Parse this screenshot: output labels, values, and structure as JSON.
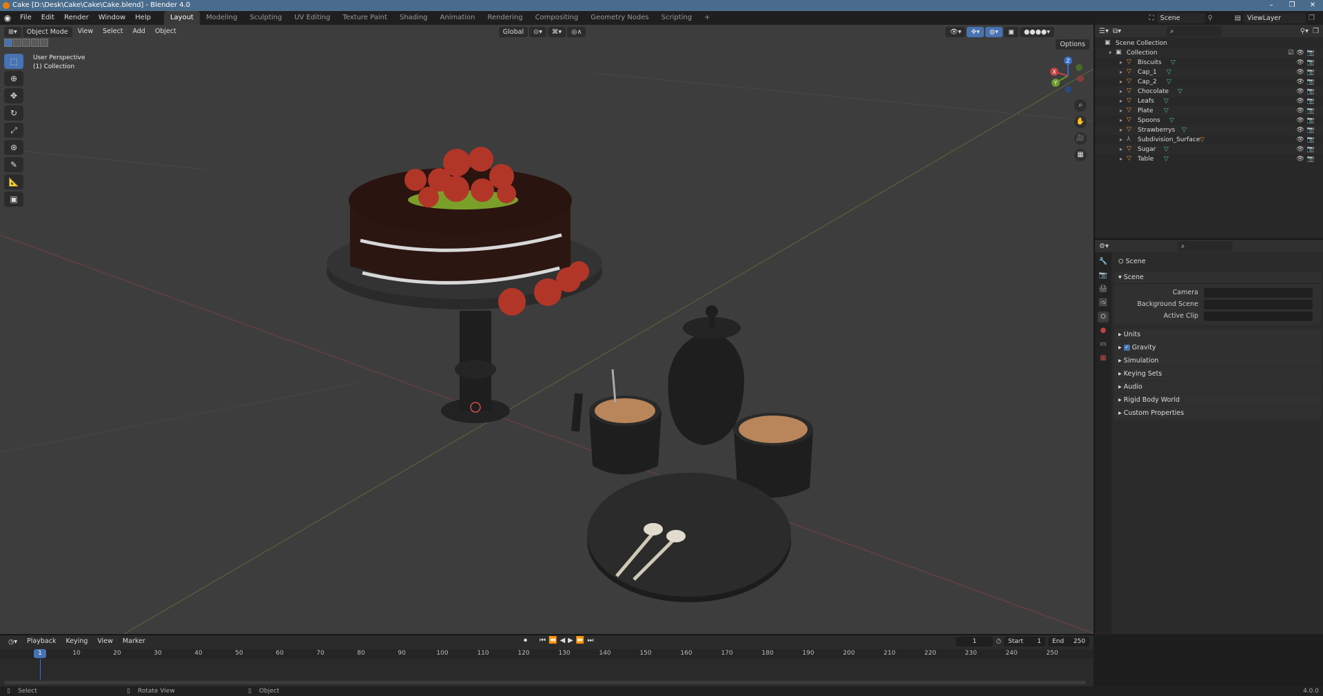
{
  "window": {
    "title": "Cake [D:\\Desk\\Cake\\Cake\\Cake.blend] - Blender 4.0",
    "controls": [
      "–",
      "❐",
      "✕"
    ]
  },
  "menu": [
    "File",
    "Edit",
    "Render",
    "Window",
    "Help"
  ],
  "workspaces": [
    "Layout",
    "Modeling",
    "Sculpting",
    "UV Editing",
    "Texture Paint",
    "Shading",
    "Animation",
    "Rendering",
    "Compositing",
    "Geometry Nodes",
    "Scripting",
    "+"
  ],
  "scene_name": "Scene",
  "view_layer": "ViewLayer",
  "viewport": {
    "mode": "Object Mode",
    "menus": [
      "View",
      "Select",
      "Add",
      "Object"
    ],
    "orientation": "Global",
    "options": "Options",
    "overlay_line1": "User Perspective",
    "overlay_line2": "(1) Collection",
    "gizmo_axes": {
      "z": "Z",
      "y": "Y",
      "x": "X"
    }
  },
  "outliner": {
    "root": "Scene Collection",
    "collection": "Collection",
    "items": [
      "Biscuits",
      "Cap_1",
      "Cap_2",
      "Chocolate",
      "Leafs",
      "Plate",
      "Spoons",
      "Strawberrys",
      "Subdivision_Surface",
      "Sugar",
      "Table"
    ]
  },
  "properties": {
    "context": "Scene",
    "panel": "Scene",
    "camera_label": "Camera",
    "background_label": "Background Scene",
    "clip_label": "Active Clip",
    "sections": [
      "Units",
      "Gravity",
      "Simulation",
      "Keying Sets",
      "Audio",
      "Rigid Body World",
      "Custom Properties"
    ]
  },
  "timeline": {
    "menus": [
      "Playback",
      "Keying",
      "View",
      "Marker"
    ],
    "current_frame": "1",
    "start_label": "Start",
    "start": "1",
    "end_label": "End",
    "end": "250",
    "ticks": [
      "10",
      "20",
      "30",
      "40",
      "50",
      "60",
      "70",
      "80",
      "90",
      "100",
      "110",
      "120",
      "130",
      "140",
      "150",
      "160",
      "170",
      "180",
      "190",
      "200",
      "210",
      "220",
      "230",
      "240",
      "250"
    ]
  },
  "status": {
    "select": "Select",
    "rotate": "Rotate View",
    "object": "Object",
    "version": "4.0.0"
  }
}
